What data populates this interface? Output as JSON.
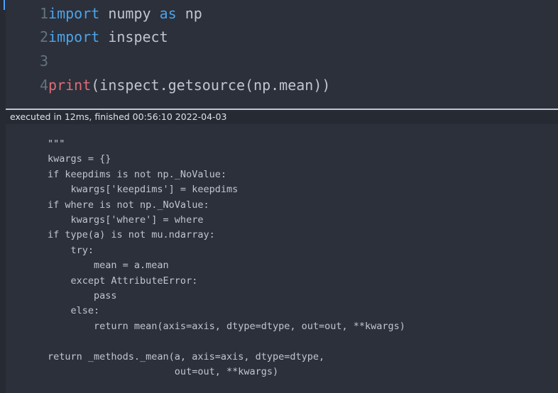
{
  "editor": {
    "lines": [
      {
        "num": "1",
        "tokens": [
          {
            "t": "import",
            "c": "kw"
          },
          {
            "t": " numpy ",
            "c": ""
          },
          {
            "t": "as",
            "c": "kw"
          },
          {
            "t": " np",
            "c": ""
          }
        ]
      },
      {
        "num": "2",
        "tokens": [
          {
            "t": "import",
            "c": "kw"
          },
          {
            "t": " inspect",
            "c": ""
          }
        ]
      },
      {
        "num": "3",
        "tokens": []
      },
      {
        "num": "4",
        "tokens": [
          {
            "t": "print",
            "c": "fn"
          },
          {
            "t": "(inspect.getsource(np.mean))",
            "c": ""
          }
        ]
      }
    ]
  },
  "status": {
    "text": "executed in 12ms, finished 00:56:10 2022-04-03"
  },
  "output": {
    "lines": [
      "\"\"\"",
      "kwargs = {}",
      "if keepdims is not np._NoValue:",
      "    kwargs['keepdims'] = keepdims",
      "if where is not np._NoValue:",
      "    kwargs['where'] = where",
      "if type(a) is not mu.ndarray:",
      "    try:",
      "        mean = a.mean",
      "    except AttributeError:",
      "        pass",
      "    else:",
      "        return mean(axis=axis, dtype=dtype, out=out, **kwargs)",
      "",
      "return _methods._mean(a, axis=axis, dtype=dtype,",
      "                      out=out, **kwargs)"
    ]
  },
  "colors": {
    "background": "#2b303b",
    "keyword": "#4ea3e8",
    "builtin": "#e06c75",
    "line_number": "#65737e",
    "text": "#c0c5ce"
  }
}
